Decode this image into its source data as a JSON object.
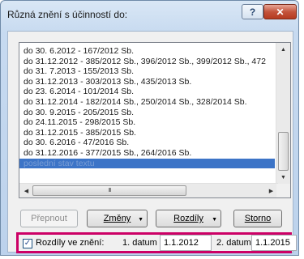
{
  "window": {
    "title": "Různá znění s účinností do:",
    "help_glyph": "?",
    "close_glyph": "✕"
  },
  "list": {
    "items": [
      {
        "label": "do 30. 6.2012 -  167/2012 Sb."
      },
      {
        "label": "do 31.12.2012 -  385/2012 Sb., 396/2012 Sb., 399/2012 Sb., 472"
      },
      {
        "label": "do 31. 7.2013 -  155/2013 Sb."
      },
      {
        "label": "do 31.12.2013 -  303/2013 Sb., 435/2013 Sb."
      },
      {
        "label": "do 23. 6.2014 -  101/2014 Sb."
      },
      {
        "label": "do 31.12.2014 -  182/2014 Sb., 250/2014 Sb., 328/2014 Sb."
      },
      {
        "label": "do 30. 9.2015 -  205/2015 Sb."
      },
      {
        "label": "do 24.11.2015 -  298/2015 Sb."
      },
      {
        "label": "do 31.12.2015 -  385/2015 Sb."
      },
      {
        "label": "do 30. 6.2016 -  47/2016 Sb."
      },
      {
        "label": "do 31.12.2016 -  377/2015 Sb., 264/2016 Sb."
      },
      {
        "label": "poslední stav textu"
      }
    ],
    "selected_index": 11,
    "hscroll_thumb_grip": "III"
  },
  "buttons": {
    "prepnout": "Přepnout",
    "zmeny": "Změny",
    "rozdily": "Rozdíly",
    "storno": "Storno"
  },
  "options": {
    "checkbox_label": "Rozdíly ve znění:",
    "checked": true,
    "date1_label": "1. datum",
    "date1_value": "1.1.2012",
    "date2_label": "2. datum",
    "date2_value": "1.1.2015"
  }
}
